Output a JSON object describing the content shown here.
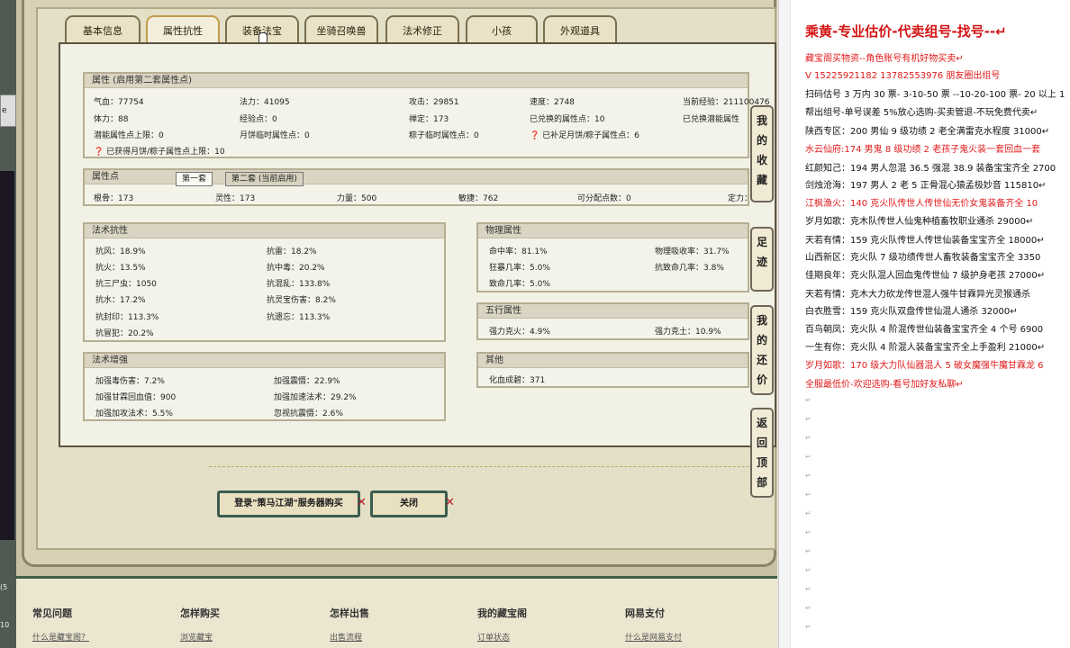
{
  "left": {
    "tab": "e",
    "n1": "(5",
    "n2": "10"
  },
  "tabs": [
    "基本信息",
    "属性抗性",
    "装备法宝",
    "坐骑召唤兽",
    "法术修正",
    "小孩",
    "外观道具"
  ],
  "attrs": {
    "header": "属性 (启用第二套属性点)",
    "r1": [
      "气血：77754",
      "法力：41095",
      "攻击：29851",
      "速度：2748",
      "当前经验：211100476"
    ],
    "r2": [
      "体力：88",
      "经验点：0",
      "禅定：173",
      "已兑换的属性点：10",
      "已兑换潜能属性"
    ],
    "r3": [
      "潜能属性点上限：0",
      "月饼临时属性点：0",
      "粽子临时属性点：0",
      "❓ 已补足月饼/粽子属性点：6"
    ],
    "r4": "❓ 已获得月饼/粽子属性点上限：10"
  },
  "points": {
    "header": "属性点",
    "tabs": [
      "第一套",
      "第二套 (当前启用)"
    ],
    "vals": [
      "根骨：173",
      "灵性：173",
      "力量：500",
      "敏捷：762",
      "可分配点数：0",
      "定力：173"
    ]
  },
  "resist": {
    "header": "法术抗性",
    "l": [
      "抗风：18.9%",
      "抗火：13.5%",
      "抗三尸虫：1050",
      "抗水：17.2%",
      "抗封印：113.3%",
      "抗冒犯：20.2%"
    ],
    "r": [
      "抗雷：18.2%",
      "抗中毒：20.2%",
      "抗混乱：133.8%",
      "抗灵宝伤害：8.2%",
      "抗遗忘：113.3%"
    ]
  },
  "phys": {
    "header": "物理属性",
    "l": [
      "命中率：81.1%",
      "狂暴几率：5.0%",
      "致命几率：5.0%"
    ],
    "r": [
      "物理吸收率：31.7%",
      "抗致命几率：3.8%"
    ]
  },
  "wx": {
    "header": "五行属性",
    "l": "强力克火：4.9%",
    "r": "强力克土：10.9%"
  },
  "enh": {
    "header": "法术增强",
    "l": [
      "加强毒伤害：7.2%",
      "加强甘霖回血值：900",
      "加强加攻法术：5.5%"
    ],
    "r": [
      "加强震慑：22.9%",
      "加强加速法术：29.2%",
      "忽视抗震慑：2.6%"
    ]
  },
  "other": {
    "header": "其他",
    "v": "化血成碧：371"
  },
  "buttons": {
    "login": "登录\"策马江湖\"服务器购买",
    "close": "关闭",
    "x": "✕"
  },
  "vtabs": [
    "我的收藏",
    "足迹",
    "我的还价",
    "返回顶部"
  ],
  "footer": {
    "heads": [
      "常见问题",
      "怎样购买",
      "怎样出售",
      "我的藏宝阁",
      "网易支付"
    ],
    "links": [
      "什么是藏宝阁？",
      "浏览藏宝",
      "出售流程",
      "订单状态",
      "什么是网易支付"
    ]
  },
  "doc": {
    "title": "乘黄-专业估价-代卖组号-找号--↵",
    "lines": [
      "藏宝阁买物资--角色账号有机好物买卖↵",
      "V 15225921182   13782553976 朋友圈出组号",
      "扫码估号 3 万内 30 票- 3-10-50 票  --10-20-100 票- 20 以上 1",
      "帮出组号-单号误差 5%放心选购-买卖管退-不玩免费代卖↵",
      "陕西专区：200 男仙 9 级功绩 2 老全满雷克水程度 31000↵",
      "水云仙府:174 男鬼 8 级功绩 2 老孩子鬼火装一套回血一套",
      "红颜知己：194 男人忽混 36.5 强混 38.9 装备宝宝齐全 2700",
      "剑烛沧海：197 男人 2 老 5 正骨混心猿孟极妙音 115810↵",
      "江枫渔火：140 克火队传世人传世仙无价女鬼装备齐全 10",
      "岁月如歌：克木队传世人仙鬼种植畜牧职业通杀 29000↵",
      "天若有情：159 克火队传世人传世仙装备宝宝齐全 18000↵",
      "山西新区：克火队 7 级功绩传世人畜牧装备宝宝齐全 3350",
      "佳期良年：克火队混人回血鬼传世仙 7 级护身老孩 27000↵",
      "天若有情：克木大力砍龙传世混人强牛甘霖异光灵猴通杀",
      "白衣胜雪：159 克火队双盘传世仙混人通杀 32000↵",
      "百鸟朝凤：克火队 4 阶混传世仙装备宝宝齐全 4 个号 6900",
      "一生有你：克火队 4 阶混人装备宝宝齐全上手盈利 21000↵",
      "岁月如歌：170 级大力队仙器混人 5 破女魔强牛魔甘霖龙 6",
      "全服最低价-欢迎选购-看号加好友私聊↵"
    ],
    "pm": "↵"
  }
}
